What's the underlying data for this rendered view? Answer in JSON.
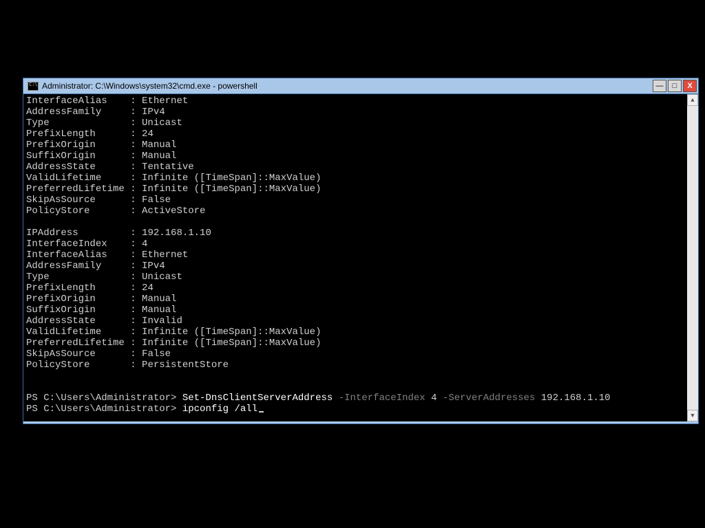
{
  "window": {
    "title": "Administrator: C:\\Windows\\system32\\cmd.exe - powershell"
  },
  "block1": {
    "InterfaceAlias": "Ethernet",
    "AddressFamily": "IPv4",
    "Type": "Unicast",
    "PrefixLength": "24",
    "PrefixOrigin": "Manual",
    "SuffixOrigin": "Manual",
    "AddressState": "Tentative",
    "ValidLifetime": "Infinite ([TimeSpan]::MaxValue)",
    "PreferredLifetime": "Infinite ([TimeSpan]::MaxValue)",
    "SkipAsSource": "False",
    "PolicyStore": "ActiveStore"
  },
  "block2": {
    "IPAddress": "192.168.1.10",
    "InterfaceIndex": "4",
    "InterfaceAlias": "Ethernet",
    "AddressFamily": "IPv4",
    "Type": "Unicast",
    "PrefixLength": "24",
    "PrefixOrigin": "Manual",
    "SuffixOrigin": "Manual",
    "AddressState": "Invalid",
    "ValidLifetime": "Infinite ([TimeSpan]::MaxValue)",
    "PreferredLifetime": "Infinite ([TimeSpan]::MaxValue)",
    "SkipAsSource": "False",
    "PolicyStore": "PersistentStore"
  },
  "prompt1": {
    "ps": "PS C:\\Users\\Administrator>",
    "cmd": "Set-DnsClientServerAddress",
    "p1flag": "-InterfaceIndex",
    "p1val": "4",
    "p2flag": "-ServerAddresses",
    "p2val": "192.168.1.10"
  },
  "prompt2": {
    "ps": "PS C:\\Users\\Administrator>",
    "cmd": "ipconfig /all"
  },
  "labels": {
    "InterfaceAlias": "InterfaceAlias",
    "AddressFamily": "AddressFamily",
    "Type": "Type",
    "PrefixLength": "PrefixLength",
    "PrefixOrigin": "PrefixOrigin",
    "SuffixOrigin": "SuffixOrigin",
    "AddressState": "AddressState",
    "ValidLifetime": "ValidLifetime",
    "PreferredLifetime": "PreferredLifetime",
    "SkipAsSource": "SkipAsSource",
    "PolicyStore": "PolicyStore",
    "IPAddress": "IPAddress",
    "InterfaceIndex": "InterfaceIndex"
  },
  "controls": {
    "min": "—",
    "max": "□",
    "close": "X"
  }
}
